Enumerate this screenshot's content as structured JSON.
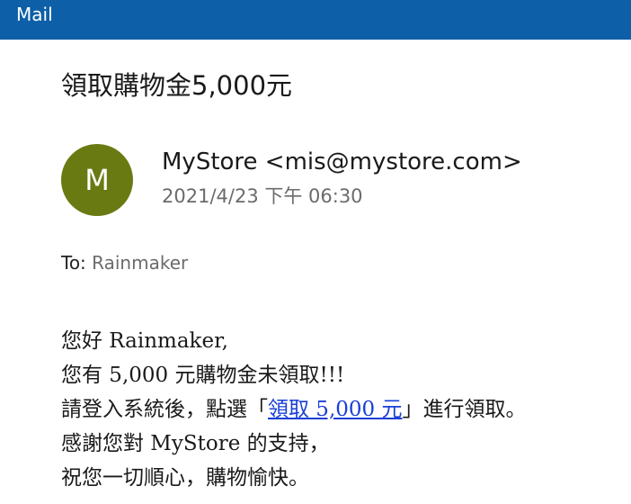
{
  "app": {
    "title": "Mail"
  },
  "email": {
    "subject": "領取購物金5,000元",
    "avatar_initial": "M",
    "sender": "MyStore <mis@mystore.com>",
    "date": "2021/4/23 下午 06:30",
    "to_label": "To:",
    "to_value": "Rainmaker",
    "avatar_color": "#6a7a12"
  },
  "body": {
    "line1": "您好 Rainmaker,",
    "line2": "您有 5,000 元購物金未領取!!!",
    "line3_before": "請登入系統後，點選「",
    "line3_link": "領取 5,000 元",
    "line3_after": "」進行領取。",
    "line4": "感謝您對 MyStore 的支持，",
    "line5": "祝您一切順心，購物愉快。"
  },
  "colors": {
    "titlebar": "#0d5fa8",
    "link": "#1a3fd6"
  }
}
